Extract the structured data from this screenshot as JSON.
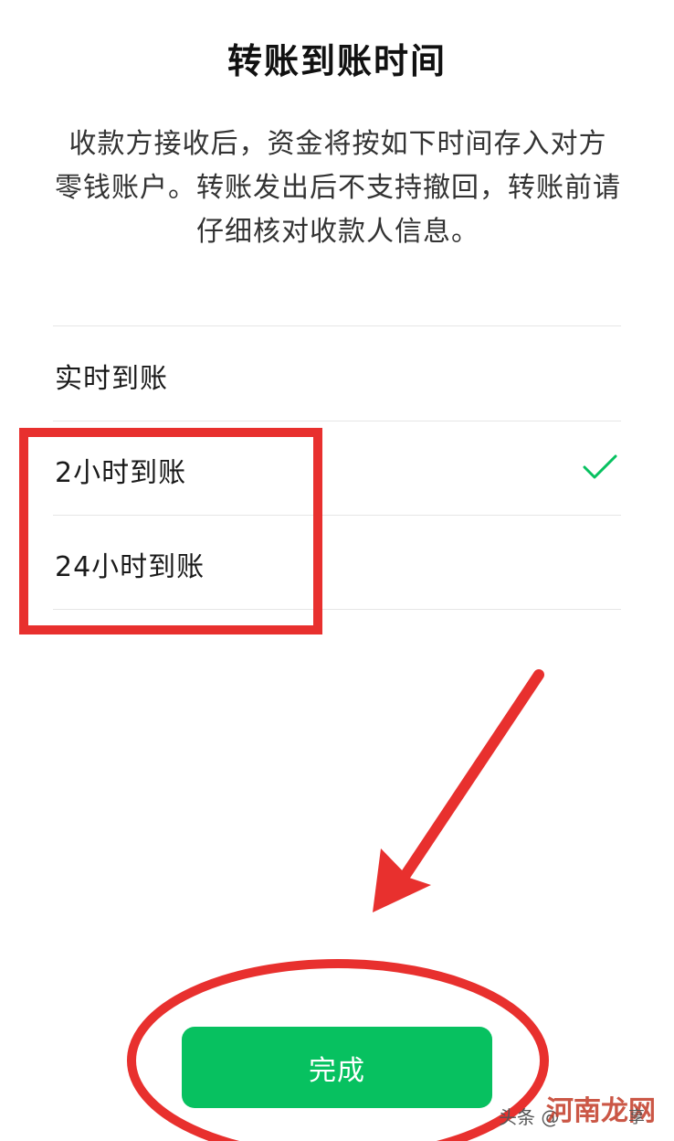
{
  "header": {
    "title": "转账到账时间"
  },
  "description": {
    "lines": [
      "收款方接收后，资金将按如下时间存入对方",
      "零钱账户。转账发出后不支持撤回，转账前请",
      "仔细核对收款人信息。"
    ]
  },
  "options": [
    {
      "label": "实时到账",
      "selected": false
    },
    {
      "label": "2小时到账",
      "selected": true
    },
    {
      "label": "24小时到账",
      "selected": false
    }
  ],
  "footer": {
    "done_label": "完成"
  },
  "colors": {
    "accent": "#07c160",
    "annotation": "#e8302e"
  },
  "watermark": {
    "left": "头条 @",
    "right": "河南龙网",
    "tail": "享"
  }
}
